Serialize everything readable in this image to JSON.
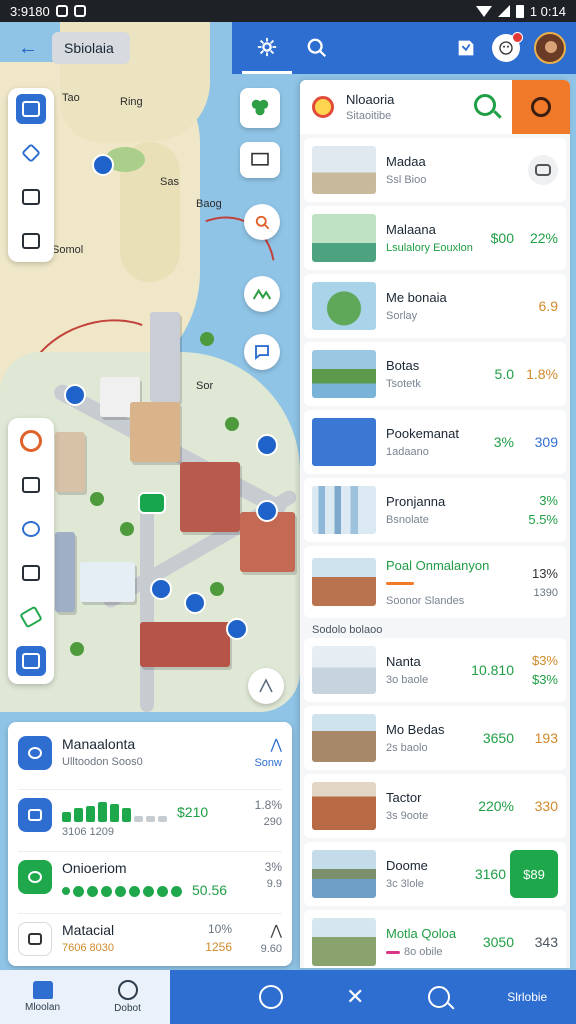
{
  "status_bar": {
    "time": "3:9180",
    "right_time": "1 0:14"
  },
  "header": {
    "search_chip": "Sbiolaia"
  },
  "map": {
    "labels": [
      "Tao",
      "Ring",
      "Sas",
      "Baog",
      "Somol",
      "Sor"
    ]
  },
  "summary_card": {
    "rows": [
      {
        "title": "Manaalonta",
        "sub": "Ulltoodon Soos0",
        "v1": "",
        "v2": "Sonw",
        "icon_color": "#2e6ed1"
      },
      {
        "title": "",
        "sub": "3106 1209",
        "amount": "$210",
        "v1": "1.8%",
        "v2": "290",
        "icon_color": "#2e6ed1"
      },
      {
        "title": "Onioeriom",
        "sub": "",
        "amount": "50.56",
        "v1": "3%",
        "v2": "9.9",
        "icon_color": "#1fa84b"
      },
      {
        "title": "Matacial",
        "sub": "7606 8030",
        "amount": "1256",
        "v1": "10%",
        "v2": "9.60",
        "icon_color": "#ffffff"
      }
    ],
    "bars": [
      10,
      14,
      16,
      20,
      18,
      14,
      6,
      6,
      6
    ],
    "dots": 9
  },
  "list_panel": {
    "header_title": "Nloaoria",
    "header_sub": "Sitaoitibe",
    "section_label": "Sodolo bolaoo",
    "items": [
      {
        "title": "Madaa",
        "sub": "Ssl Bioo",
        "v1": "",
        "v2": "",
        "thumb": "#c9b99b"
      },
      {
        "title": "Malaana",
        "sub": "Lsulalory Eouxlon",
        "v1": "$00",
        "v2": "22%",
        "thumb": "#4da37f",
        "title_color": "#1b2733",
        "sub_color": "#1f9e45",
        "v1_color": "#1f9e45",
        "v2_color": "#1f9e45"
      },
      {
        "title": "Me bonaia",
        "sub": "Sorlay",
        "v1": "",
        "v2": "6.9",
        "thumb": "#5fa85a",
        "v2_color": "#d08a2c"
      },
      {
        "title": "Botas",
        "sub": "Tsotetk",
        "v1": "5.0",
        "v2": "1.8%",
        "thumb": "#79b4d8",
        "v1_color": "#1f9e45",
        "v2_color": "#d08a2c"
      },
      {
        "title": "Pookemanat",
        "sub": "1adaano",
        "v1": "3%",
        "v2": "309",
        "thumb": "#3b78d4",
        "v1_color": "#1f9e45",
        "v2_color": "#2e6ed1"
      },
      {
        "title": "Pronjanna",
        "sub": "Bsnolate",
        "v1": "",
        "v2": "3%",
        "v3": "5.5%",
        "thumb": "#a6c8e3",
        "v2_color": "#1f9e45",
        "v3_color": "#1f9e45"
      },
      {
        "title": "Poal Onmalanyon",
        "sub": "Soonor Slandes",
        "v1": "",
        "v2": "13%",
        "v3": "1390",
        "thumb": "#b9734e",
        "title_color": "#1f9e45"
      },
      {
        "title": "Nanta",
        "sub": "3o baole",
        "v1": "10.810",
        "v2": "$3%",
        "v3": "$3%",
        "thumb": "#c7d3dd",
        "v1_color": "#1f9e45",
        "v2_color": "#d08a2c",
        "v3_color": "#1f9e45"
      },
      {
        "title": "Mo Bedas",
        "sub": "2s baolo",
        "v1": "3650",
        "v2": "193",
        "thumb": "#a7896a",
        "v1_color": "#1f9e45",
        "v2_color": "#d08a2c"
      },
      {
        "title": "Tactor",
        "sub": "3s 9oote",
        "v1": "220%",
        "v2": "330",
        "thumb": "#b86a45",
        "v1_color": "#1f9e45",
        "v2_color": "#d08a2c"
      },
      {
        "title": "Doome",
        "sub": "3c 3lole",
        "v1": "3160",
        "v2": "$89",
        "thumb": "#6f9fc4",
        "v1_color": "#1f9e45"
      },
      {
        "title": "Motla Qoloa",
        "sub": "8o obile",
        "v1": "3050",
        "v2": "343",
        "thumb": "#8aa26c",
        "title_color": "#1f9e45",
        "v1_color": "#1f9e45"
      }
    ]
  },
  "bottom_nav": {
    "tab1": "Mloolan",
    "tab2": "Dobot",
    "right_label": "Slrlobie"
  }
}
